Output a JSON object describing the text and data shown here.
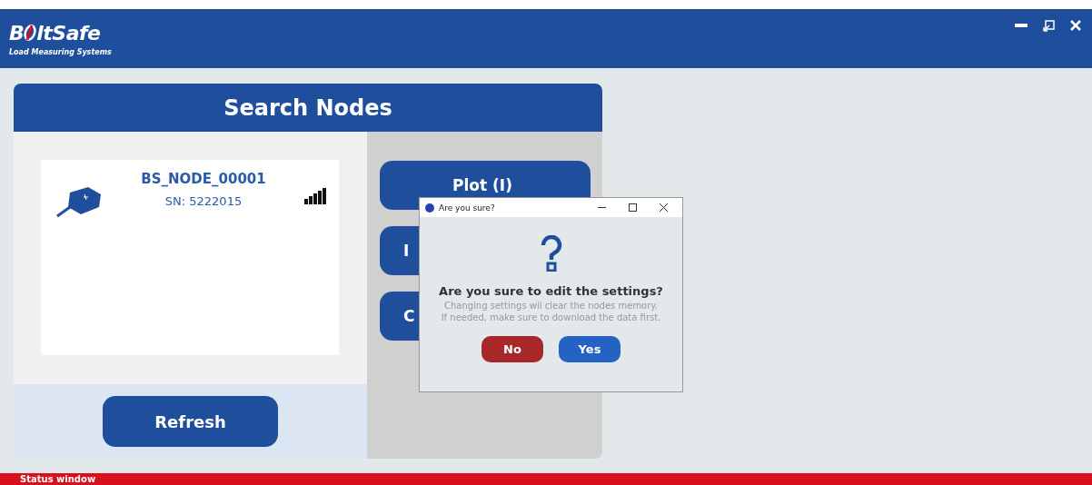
{
  "header": {
    "logo_parts": [
      "B",
      "ltSafe"
    ],
    "tagline": "Load Measuring Systems"
  },
  "panel": {
    "title": "Search Nodes",
    "nodes": [
      {
        "name": "BS_NODE_00001",
        "serial": "SN: 5222015"
      }
    ],
    "refresh": "Refresh",
    "actions": [
      {
        "label": "Plot (I)"
      },
      {
        "label": "I"
      },
      {
        "label": "C"
      }
    ]
  },
  "dialog": {
    "title": "Are you sure?",
    "question": "Are you sure to edit the settings?",
    "message_lines": [
      "Changing settings wil clear the nodes memory.",
      "If needed, make sure to download the data first."
    ],
    "buttons": [
      {
        "label": "No",
        "kind": "cancel"
      },
      {
        "label": "Yes",
        "kind": "confirm"
      }
    ]
  },
  "status_bar": {
    "label": "Status window"
  }
}
